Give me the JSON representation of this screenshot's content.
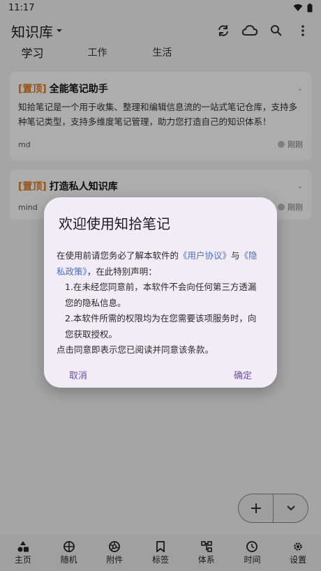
{
  "status_bar": {
    "time": "11:17"
  },
  "app_bar": {
    "title": "知识库"
  },
  "tabs": [
    {
      "label": "学习",
      "active": true
    },
    {
      "label": "工作",
      "active": false
    },
    {
      "label": "生活",
      "active": false
    }
  ],
  "cards": [
    {
      "tag": "[置顶]",
      "title": "全能笔记助手",
      "body": "知拾笔记是一个用于收集、整理和编辑信息流的一站式笔记仓库，支持多种笔记类型，支持多维度笔记管理，助力您打造自己的知识体系！",
      "type": "md",
      "time": "刚刚"
    },
    {
      "tag": "[置顶]",
      "title": "打造私人知识库",
      "body": "",
      "type": "mind",
      "time": "刚刚"
    }
  ],
  "fab": {
    "add_icon": "+",
    "expand_icon": "chevron-down"
  },
  "bottom_nav": [
    {
      "label": "主页",
      "icon": "shapes-icon"
    },
    {
      "label": "随机",
      "icon": "dice-icon"
    },
    {
      "label": "附件",
      "icon": "aperture-icon"
    },
    {
      "label": "标签",
      "icon": "bookmark-icon"
    },
    {
      "label": "体系",
      "icon": "tree-icon"
    },
    {
      "label": "时间",
      "icon": "clock-icon"
    },
    {
      "label": "设置",
      "icon": "gear-icon"
    }
  ],
  "dialog": {
    "title": "欢迎使用知拾笔记",
    "intro_prefix": "在使用前请您务必了解本软件的",
    "link_user": "《用户协议》",
    "connector": "与",
    "link_privacy": "《隐私政策》",
    "intro_suffix": "，在此特别声明：",
    "point1": "1.在未经您同意前，本软件不会向任何第三方透漏您的隐私信息。",
    "point2": "2.本软件所需的权限均为在您需要该项服务时，向您获取授权。",
    "footer": "点击同意即表示您已阅读并同意该条款。",
    "cancel_label": "取消",
    "confirm_label": "确定"
  },
  "colors": {
    "tag": "#e07b1f",
    "link": "#4b6fc2",
    "dialog_button": "#6b4fa6",
    "dialog_bg": "#f1ecf6"
  }
}
